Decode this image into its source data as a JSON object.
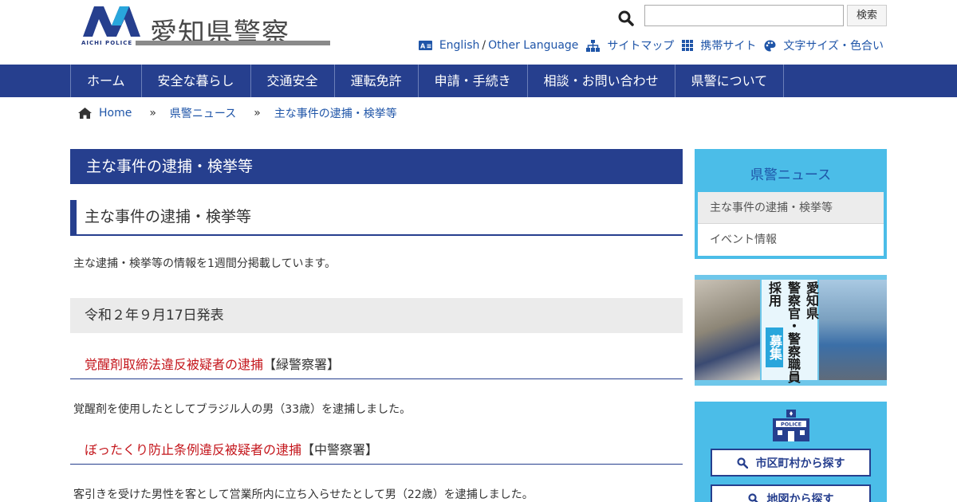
{
  "header": {
    "logo_text": "愛知県警察",
    "logo_sub": "AICHI POLICE",
    "search_button": "検索",
    "search_value": "",
    "util_nav": [
      {
        "icon": "language-icon",
        "label": "English"
      },
      {
        "icon": "",
        "label": "Other Language"
      },
      {
        "icon": "sitemap-icon",
        "label": "サイトマップ"
      },
      {
        "icon": "grid-icon",
        "label": "携帯サイト"
      },
      {
        "icon": "palette-icon",
        "label": "文字サイズ・色合い"
      }
    ],
    "util_separator": "/"
  },
  "gnav": {
    "items": [
      "ホーム",
      "安全な暮らし",
      "交通安全",
      "運転免許",
      "申請・手続き",
      "相談・お問い合わせ",
      "県警について"
    ]
  },
  "breadcrumb": {
    "items": [
      "Home",
      "県警ニュース",
      "主な事件の逮捕・検挙等"
    ],
    "separator": "»"
  },
  "main": {
    "page_title": "主な事件の逮捕・検挙等",
    "section_title": "主な事件の逮捕・検挙等",
    "intro": "主な逮捕・検挙等の情報を1週間分掲載しています。",
    "date_heading": "令和２年９月17日発表",
    "news": [
      {
        "title": "覚醒剤取締法違反被疑者の逮捕",
        "station": "【緑警察署】",
        "desc": "覚醒剤を使用したとしてブラジル人の男（33歳）を逮捕しました。"
      },
      {
        "title": "ぼったくり防止条例違反被疑者の逮捕",
        "station": "【中警察署】",
        "desc": "客引きを受けた男性を客として営業所内に立ち入らせたとして男（22歳）を逮捕しました。"
      }
    ]
  },
  "sidebar": {
    "news_title": "県警ニュース",
    "news_items": [
      "主な事件の逮捕・検挙等",
      "イベント情報"
    ],
    "banner": {
      "line1": "愛知県",
      "line2": "警察官・警察職員",
      "line3": "採用",
      "line4": "募集"
    },
    "station": {
      "icon_label": "POLICE",
      "buttons": [
        "市区町村から探す",
        "地図から探す"
      ]
    }
  },
  "colors": {
    "navy": "#263f8e",
    "accent_blue": "#4bbde8",
    "link": "#1f55a8",
    "news_red": "#c4161c"
  }
}
